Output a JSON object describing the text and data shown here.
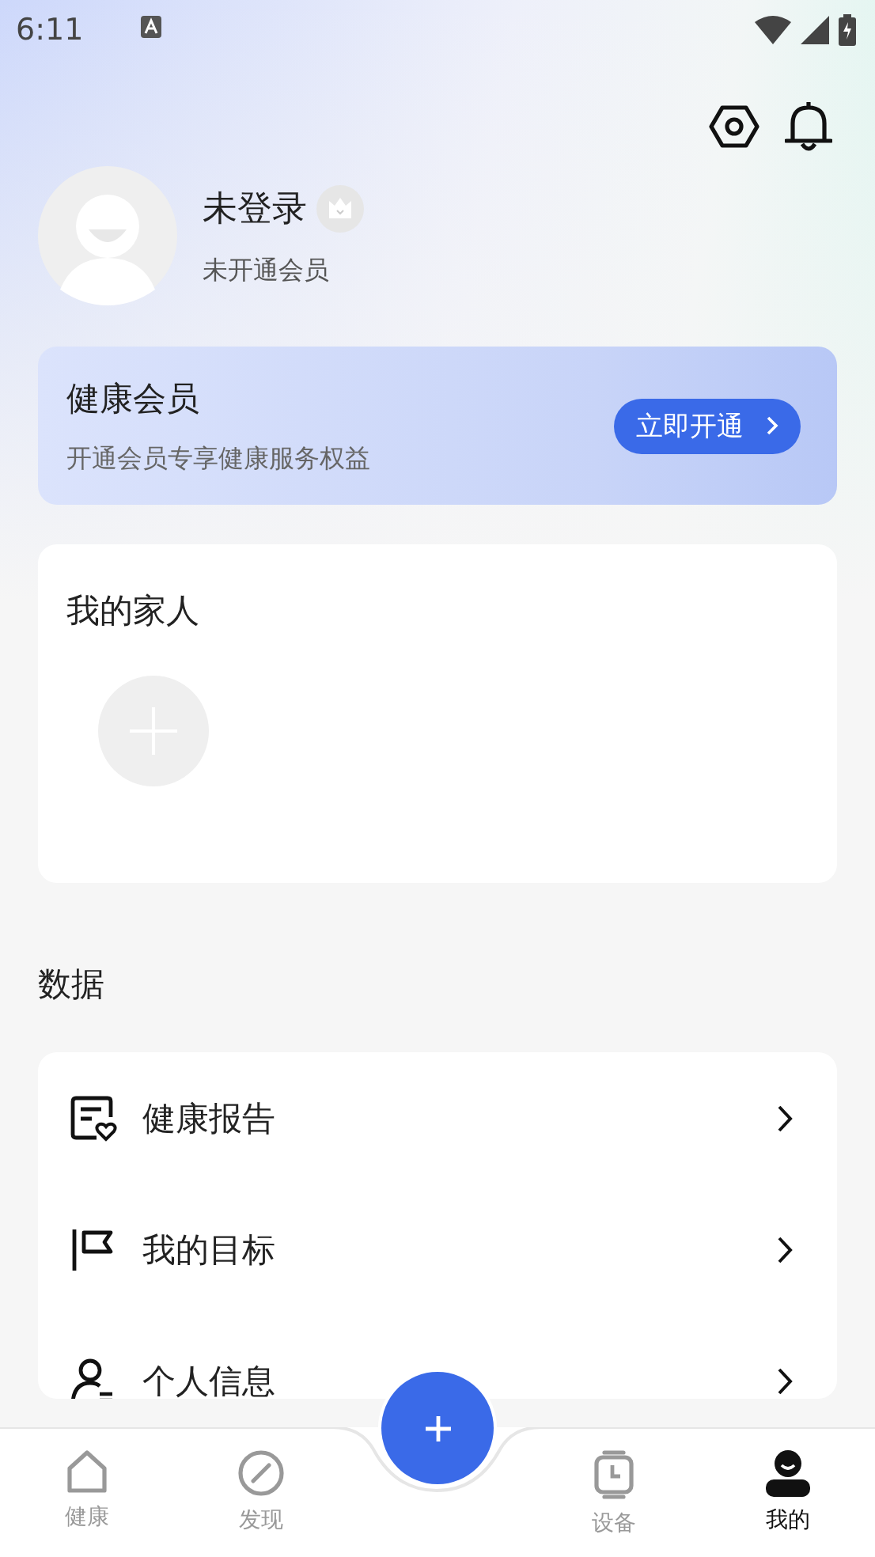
{
  "status_bar": {
    "time": "6:11"
  },
  "profile": {
    "name": "未登录",
    "membership": "未开通会员"
  },
  "member_card": {
    "title": "健康会员",
    "subtitle": "开通会员专享健康服务权益",
    "button": "立即开通"
  },
  "family": {
    "title": "我的家人"
  },
  "data_section": {
    "title": "数据",
    "items": [
      {
        "kind": "report",
        "label": "健康报告"
      },
      {
        "kind": "goal",
        "label": "我的目标"
      },
      {
        "kind": "profile",
        "label": "个人信息"
      }
    ]
  },
  "tabs": [
    {
      "kind": "home",
      "label": "健康",
      "selected": false
    },
    {
      "kind": "discover",
      "label": "发现",
      "selected": false
    },
    {
      "kind": "device",
      "label": "设备",
      "selected": false
    },
    {
      "kind": "me",
      "label": "我的",
      "selected": true
    }
  ]
}
